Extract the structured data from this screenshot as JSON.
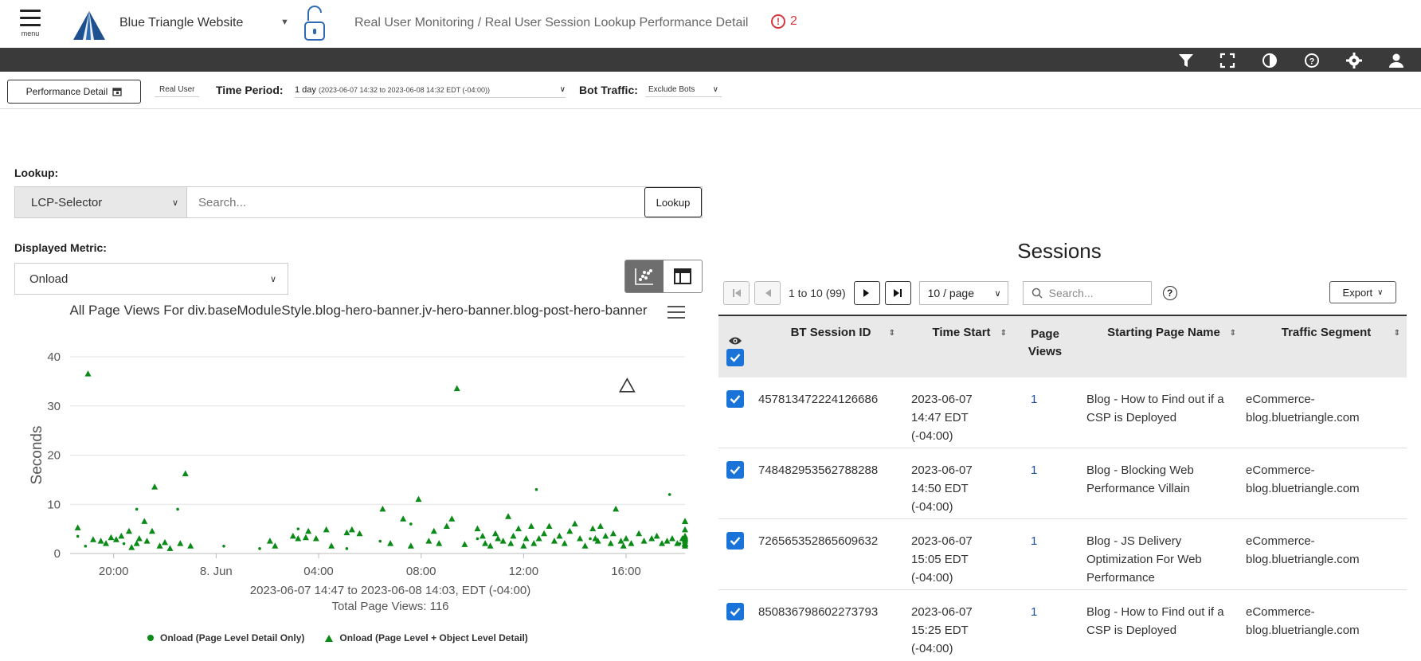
{
  "header": {
    "menu_label": "menu",
    "site_name": "Blue Triangle Website",
    "breadcrumb": "Real User Monitoring / Real User Session Lookup Performance Detail",
    "alert_count": "2",
    "icons": [
      "filter-icon",
      "fullscreen-icon",
      "contrast-icon",
      "help-icon",
      "settings-icon",
      "user-icon"
    ]
  },
  "filters": {
    "perf_detail_label": "Performance Detail",
    "real_user_label": "Real User",
    "time_period_label": "Time Period:",
    "time_period_value": "1 day",
    "time_period_range": "(2023-06-07 14:32 to 2023-06-08 14:32 EDT (-04:00))",
    "bot_label": "Bot Traffic:",
    "bot_value": "Exclude Bots"
  },
  "lookup": {
    "label": "Lookup:",
    "selector": "LCP-Selector",
    "placeholder": "Search...",
    "button": "Lookup"
  },
  "metric": {
    "label": "Displayed Metric:",
    "value": "Onload"
  },
  "chart": {
    "title": "All Page Views For div.baseModuleStyle.blog-hero-banner.jv-hero-banner.blog-post-hero-banner",
    "subtitle": "2023-06-07 14:47 to 2023-06-08 14:03, EDT (-04:00)",
    "total": "Total Page Views: 116"
  },
  "chart_data": {
    "type": "scatter",
    "title": "All Page Views For div.baseModuleStyle.blog-hero-banner.jv-hero-banner.blog-post-hero-banner",
    "ylabel": "Seconds",
    "xlabel": "",
    "ylim": [
      0,
      40
    ],
    "yticks": [
      0,
      10,
      20,
      30,
      40
    ],
    "xticks": [
      "20:00",
      "8. Jun",
      "04:00",
      "08:00",
      "12:00",
      "16:00"
    ],
    "xtick_hours": [
      20,
      24,
      28,
      32,
      36,
      40
    ],
    "xlim_hours": [
      18.3,
      42.3
    ],
    "series": [
      {
        "name": "Onload (Page Level Detail Only)",
        "marker": "circle",
        "color": "#0a8a16",
        "points": [
          [
            18.6,
            3.5
          ],
          [
            18.9,
            1.5
          ],
          [
            20.4,
            2.0
          ],
          [
            20.9,
            9.0
          ],
          [
            22.5,
            9.0
          ],
          [
            24.3,
            1.5
          ],
          [
            25.7,
            1.0
          ],
          [
            27.2,
            5.0
          ],
          [
            29.1,
            1.0
          ],
          [
            30.4,
            2.5
          ],
          [
            31.6,
            6.0
          ],
          [
            34.2,
            3.0
          ],
          [
            36.5,
            13.0
          ],
          [
            38.6,
            3.0
          ],
          [
            41.7,
            12.0
          ],
          [
            42.1,
            2.0
          ]
        ]
      },
      {
        "name": "Onload (Page Level + Object Level Detail)",
        "marker": "triangle",
        "color": "#0a8a16",
        "points": [
          [
            18.6,
            5.2
          ],
          [
            19.0,
            36.5
          ],
          [
            19.2,
            2.8
          ],
          [
            19.5,
            2.5
          ],
          [
            19.7,
            2.0
          ],
          [
            19.9,
            3.2
          ],
          [
            20.1,
            2.8
          ],
          [
            20.3,
            3.5
          ],
          [
            20.6,
            4.5
          ],
          [
            20.7,
            1.2
          ],
          [
            20.9,
            2.0
          ],
          [
            21.0,
            3.0
          ],
          [
            21.2,
            6.5
          ],
          [
            21.3,
            2.5
          ],
          [
            21.5,
            4.5
          ],
          [
            21.6,
            13.5
          ],
          [
            21.8,
            1.5
          ],
          [
            22.0,
            2.2
          ],
          [
            22.2,
            1.0
          ],
          [
            22.6,
            2.0
          ],
          [
            22.8,
            16.2
          ],
          [
            23.0,
            1.5
          ],
          [
            26.1,
            2.5
          ],
          [
            26.3,
            1.5
          ],
          [
            27.0,
            3.5
          ],
          [
            27.2,
            3.0
          ],
          [
            27.5,
            3.2
          ],
          [
            27.6,
            4.5
          ],
          [
            27.9,
            3.0
          ],
          [
            28.3,
            4.8
          ],
          [
            28.5,
            1.5
          ],
          [
            29.1,
            4.2
          ],
          [
            29.3,
            4.8
          ],
          [
            29.6,
            4.0
          ],
          [
            30.5,
            9.0
          ],
          [
            30.8,
            2.0
          ],
          [
            31.3,
            7.0
          ],
          [
            31.6,
            1.5
          ],
          [
            31.9,
            11.0
          ],
          [
            32.3,
            2.5
          ],
          [
            32.5,
            4.5
          ],
          [
            32.7,
            2.0
          ],
          [
            33.0,
            5.5
          ],
          [
            33.2,
            7.0
          ],
          [
            33.4,
            33.5
          ],
          [
            33.7,
            1.8
          ],
          [
            34.2,
            5.0
          ],
          [
            34.4,
            3.5
          ],
          [
            34.5,
            2.0
          ],
          [
            34.7,
            1.5
          ],
          [
            34.9,
            4.0
          ],
          [
            35.0,
            3.0
          ],
          [
            35.2,
            2.5
          ],
          [
            35.4,
            7.5
          ],
          [
            35.5,
            2.0
          ],
          [
            35.6,
            3.5
          ],
          [
            35.8,
            5.0
          ],
          [
            36.0,
            1.5
          ],
          [
            36.1,
            3.0
          ],
          [
            36.3,
            5.5
          ],
          [
            36.4,
            2.0
          ],
          [
            36.6,
            3.0
          ],
          [
            36.8,
            4.0
          ],
          [
            37.0,
            5.5
          ],
          [
            37.2,
            2.5
          ],
          [
            37.4,
            3.5
          ],
          [
            37.6,
            2.0
          ],
          [
            37.8,
            4.5
          ],
          [
            38.0,
            6.0
          ],
          [
            38.2,
            3.0
          ],
          [
            38.4,
            1.5
          ],
          [
            38.7,
            5.0
          ],
          [
            38.8,
            3.0
          ],
          [
            38.9,
            2.5
          ],
          [
            39.0,
            5.5
          ],
          [
            39.2,
            3.5
          ],
          [
            39.4,
            2.0
          ],
          [
            39.5,
            4.0
          ],
          [
            39.6,
            9.0
          ],
          [
            39.8,
            2.5
          ],
          [
            39.9,
            1.5
          ],
          [
            40.0,
            3.0
          ],
          [
            40.2,
            2.0
          ],
          [
            40.5,
            4.0
          ],
          [
            40.7,
            2.5
          ],
          [
            41.0,
            3.0
          ],
          [
            41.2,
            3.5
          ],
          [
            41.4,
            2.0
          ],
          [
            41.6,
            2.5
          ],
          [
            41.8,
            3.0
          ],
          [
            42.0,
            2.0
          ],
          [
            42.2,
            3.0
          ],
          [
            43.0,
            3.2
          ],
          [
            43.5,
            2.5
          ],
          [
            43.8,
            3.5
          ],
          [
            44.2,
            3.0
          ],
          [
            44.6,
            2.0
          ],
          [
            45.0,
            3.0
          ],
          [
            45.7,
            6.5
          ],
          [
            46.6,
            2.8
          ],
          [
            47.3,
            1.5
          ],
          [
            47.6,
            2.0
          ],
          [
            47.8,
            6.5
          ],
          [
            47.9,
            1.8
          ],
          [
            48.2,
            4.8
          ]
        ]
      }
    ],
    "legend": "bottom"
  },
  "sessions": {
    "title": "Sessions",
    "page_info": "1 to 10 (99)",
    "per_page": "10 / page",
    "search_placeholder": "Search...",
    "export_label": "Export",
    "columns": [
      "BT Session ID",
      "Time Start",
      "Page Views",
      "Starting Page Name",
      "Traffic Segment"
    ],
    "rows": [
      {
        "id": "457813472224126686",
        "time": [
          "2023-06-07",
          "14:47 EDT",
          "(-04:00)"
        ],
        "views": "1",
        "page": "Blog - How to Find out if a CSP is Deployed",
        "segment": "eCommerce-blog.bluetriangle.com"
      },
      {
        "id": "748482953562788288",
        "time": [
          "2023-06-07",
          "14:50 EDT",
          "(-04:00)"
        ],
        "views": "1",
        "page": "Blog - Blocking Web Performance Villain",
        "segment": "eCommerce-blog.bluetriangle.com"
      },
      {
        "id": "726565352865609632",
        "time": [
          "2023-06-07",
          "15:05 EDT",
          "(-04:00)"
        ],
        "views": "1",
        "page": "Blog - JS Delivery Optimization For Web Performance",
        "segment": "eCommerce-blog.bluetriangle.com"
      },
      {
        "id": "850836798602273793",
        "time": [
          "2023-06-07",
          "15:25 EDT",
          "(-04:00)"
        ],
        "views": "1",
        "page": "Blog - How to Find out if a CSP is Deployed",
        "segment": "eCommerce-blog.bluetriangle.com"
      }
    ]
  },
  "colors": {
    "accent": "#1a73d8",
    "marker": "#0a8a16",
    "toolbar": "#3a3a3a",
    "alert": "#d9363e"
  }
}
